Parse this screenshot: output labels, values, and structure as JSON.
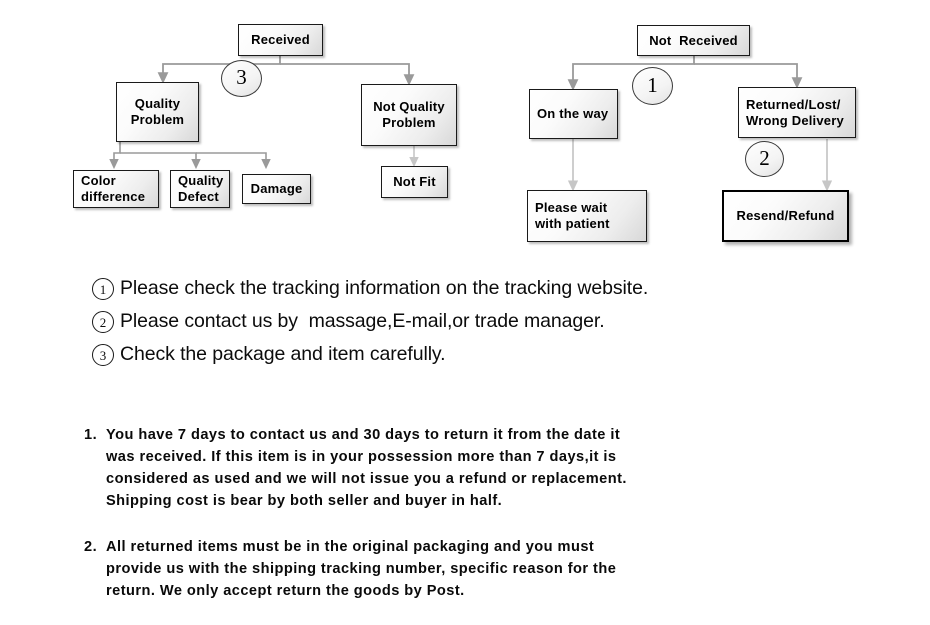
{
  "flowchart": {
    "boxes": [
      {
        "id": "received",
        "label": "Received"
      },
      {
        "id": "quality-problem",
        "lines": [
          "Quality",
          "Problem"
        ]
      },
      {
        "id": "not-quality-problem",
        "lines": [
          "Not Quality",
          "Problem"
        ]
      },
      {
        "id": "color-difference",
        "lines": [
          "Color",
          "difference"
        ]
      },
      {
        "id": "quality-defect",
        "lines": [
          "Quality",
          "Defect"
        ]
      },
      {
        "id": "damage",
        "label": "Damage"
      },
      {
        "id": "not-fit",
        "label": "Not Fit"
      },
      {
        "id": "not-received",
        "label": "Not  Received"
      },
      {
        "id": "on-the-way",
        "label": "On the way"
      },
      {
        "id": "returned-lost",
        "lines": [
          "Returned/Lost/",
          "Wrong Delivery"
        ]
      },
      {
        "id": "please-wait",
        "lines": [
          "Please wait",
          "with patient"
        ]
      },
      {
        "id": "resend-refund",
        "label": "Resend/Refund"
      }
    ],
    "markers": [
      {
        "id": "marker-3",
        "label": "3"
      },
      {
        "id": "marker-1",
        "label": "1"
      },
      {
        "id": "marker-2",
        "label": "2"
      }
    ],
    "colors": {
      "box_border": "#1a1a1a",
      "connector": "#9a9a9a",
      "text": "#000000"
    }
  },
  "notes": [
    {
      "num": "1",
      "text": "Please check the tracking information on the tracking website."
    },
    {
      "num": "2",
      "text": "Please contact us by  massage,E-mail,or trade manager."
    },
    {
      "num": "3",
      "text": "Check the package and item carefully."
    }
  ],
  "policies": [
    {
      "num": "1.",
      "lines": [
        "You have 7 days to contact us and 30 days to return it from the date it",
        "was received. If this item is in your possession more than 7 days,it is",
        "considered as used and we will not issue you a refund or replacement.",
        "Shipping cost is bear by both seller and buyer in half."
      ]
    },
    {
      "num": "2.",
      "lines": [
        "All returned items must be in the original packaging and you must",
        "provide us with the shipping tracking number, specific reason for the",
        "return. We only accept return the goods by Post."
      ]
    }
  ]
}
